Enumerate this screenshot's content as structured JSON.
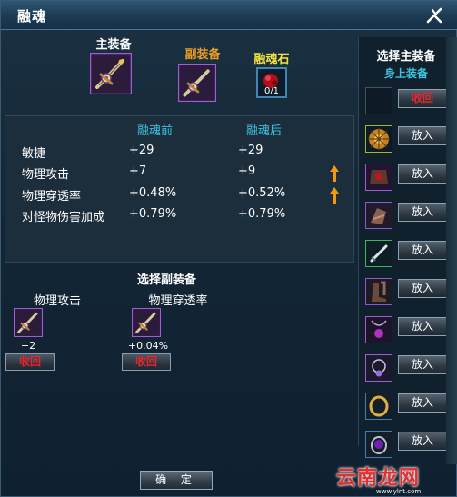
{
  "window": {
    "title": "融魂"
  },
  "fusion": {
    "main_label": "主装备",
    "sub_label": "副装备",
    "stone_label": "融魂石",
    "stone_count": "0/1"
  },
  "stats": {
    "header_before": "融魂前",
    "header_after": "融魂后",
    "rows": [
      {
        "name": "敏捷",
        "before": "+29",
        "after": "+29",
        "increased": false
      },
      {
        "name": "物理攻击",
        "before": "+7",
        "after": "+9",
        "increased": true
      },
      {
        "name": "物理穿透率",
        "before": "+0.48%",
        "after": "+0.52%",
        "increased": true
      },
      {
        "name": "对怪物伤害加成",
        "before": "+0.79%",
        "after": "+0.79%",
        "increased": false
      }
    ]
  },
  "sub_equipment": {
    "title": "选择副装备",
    "items": [
      {
        "label": "物理攻击",
        "value": "+2",
        "recall": "收回"
      },
      {
        "label": "物理穿透率",
        "value": "+0.04%",
        "recall": "收回"
      }
    ]
  },
  "confirm_label": "确 定",
  "right_panel": {
    "title": "选择主装备",
    "subtitle": "身上装备",
    "recall_label": "收回",
    "put_label": "放入",
    "items": [
      {
        "icon": "sun-charm-icon"
      },
      {
        "icon": "chest-armor-icon"
      },
      {
        "icon": "gauntlet-icon"
      },
      {
        "icon": "dagger-icon"
      },
      {
        "icon": "boots-icon"
      },
      {
        "icon": "pendant-icon"
      },
      {
        "icon": "necklace-icon"
      },
      {
        "icon": "ring-icon"
      },
      {
        "icon": "gem-ring-icon"
      }
    ]
  },
  "colors": {
    "main_label": "#ffffff",
    "sub_label": "#f0a020",
    "stone_label": "#f2e040",
    "stat_header": "#3ec2de",
    "recall_text": "#e8252a",
    "arrow": "#f09a10"
  },
  "watermark": {
    "text": "云南龙网",
    "url": "www.ylnt.com"
  }
}
